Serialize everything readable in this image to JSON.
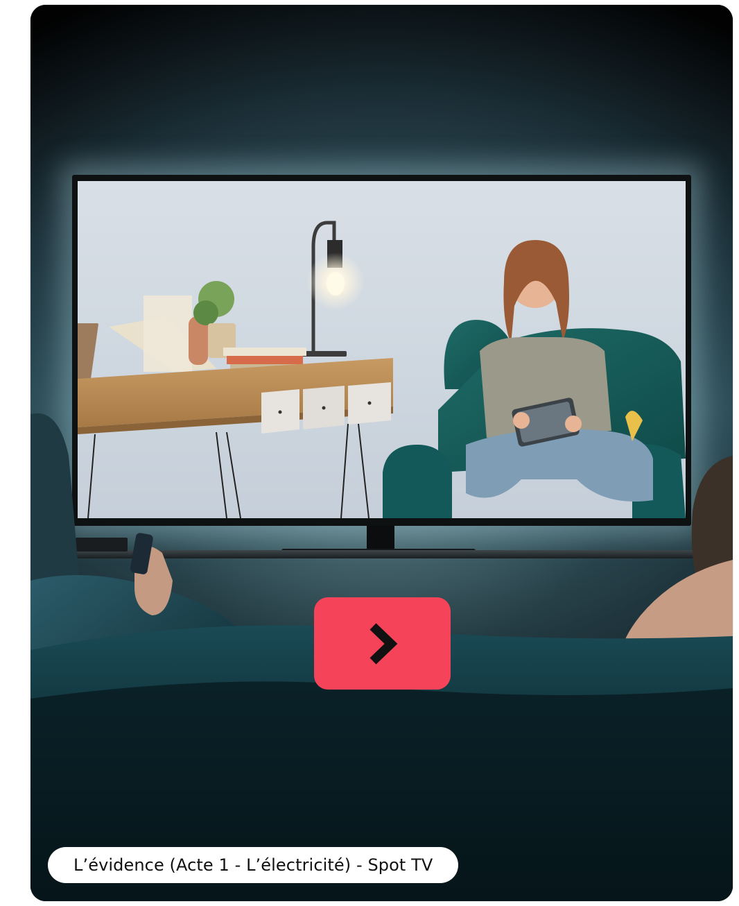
{
  "video": {
    "caption": "L’évidence (Acte 1 - L’électricité) - Spot TV",
    "play_icon": "chevron-right-icon"
  },
  "colors": {
    "play_button": "#f5445a",
    "caption_bg": "#ffffff",
    "caption_text": "#111111",
    "icon": "#111111"
  }
}
